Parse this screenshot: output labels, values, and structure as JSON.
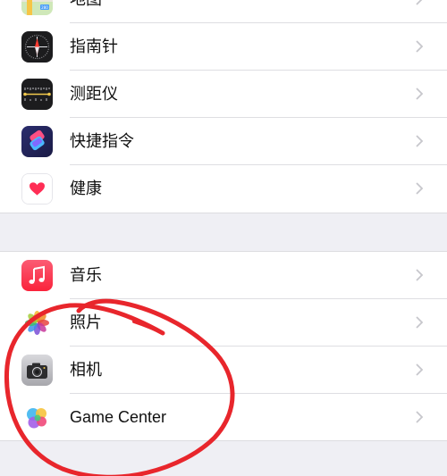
{
  "group1": {
    "items": [
      {
        "label": "地图",
        "icon": "maps-icon"
      },
      {
        "label": "指南针",
        "icon": "compass-icon"
      },
      {
        "label": "测距仪",
        "icon": "measure-icon"
      },
      {
        "label": "快捷指令",
        "icon": "shortcuts-icon"
      },
      {
        "label": "健康",
        "icon": "health-icon"
      }
    ]
  },
  "group2": {
    "items": [
      {
        "label": "音乐",
        "icon": "music-icon"
      },
      {
        "label": "照片",
        "icon": "photos-icon"
      },
      {
        "label": "相机",
        "icon": "camera-icon"
      },
      {
        "label": "Game Center",
        "icon": "game-center-icon"
      }
    ]
  },
  "colors": {
    "background": "#efeff4",
    "row_background": "#ffffff",
    "chevron": "#c7c7cc",
    "annotation": "#e8262c"
  }
}
